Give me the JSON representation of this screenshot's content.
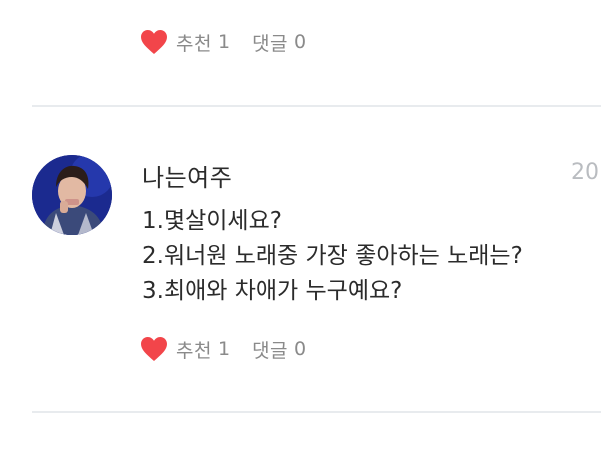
{
  "post_top": {
    "like_label": "추천",
    "like_count": "1",
    "comment_label": "댓글",
    "comment_count": "0"
  },
  "post": {
    "username": "나는여주",
    "date_partial": "20",
    "lines": [
      "1.몇살이세요?",
      "2.워너원 노래중 가장 좋아하는 노래는?",
      "3.최애와 차애가 누구예요?"
    ],
    "like_label": "추천",
    "like_count": "1",
    "comment_label": "댓글",
    "comment_count": "0"
  },
  "colors": {
    "heart": "#f2454a",
    "muted_text": "#8a8a8a",
    "divider": "#e8ebee",
    "date": "#b9bcc0"
  },
  "icons": {
    "like": "heart-icon",
    "avatar": "profile-photo"
  }
}
